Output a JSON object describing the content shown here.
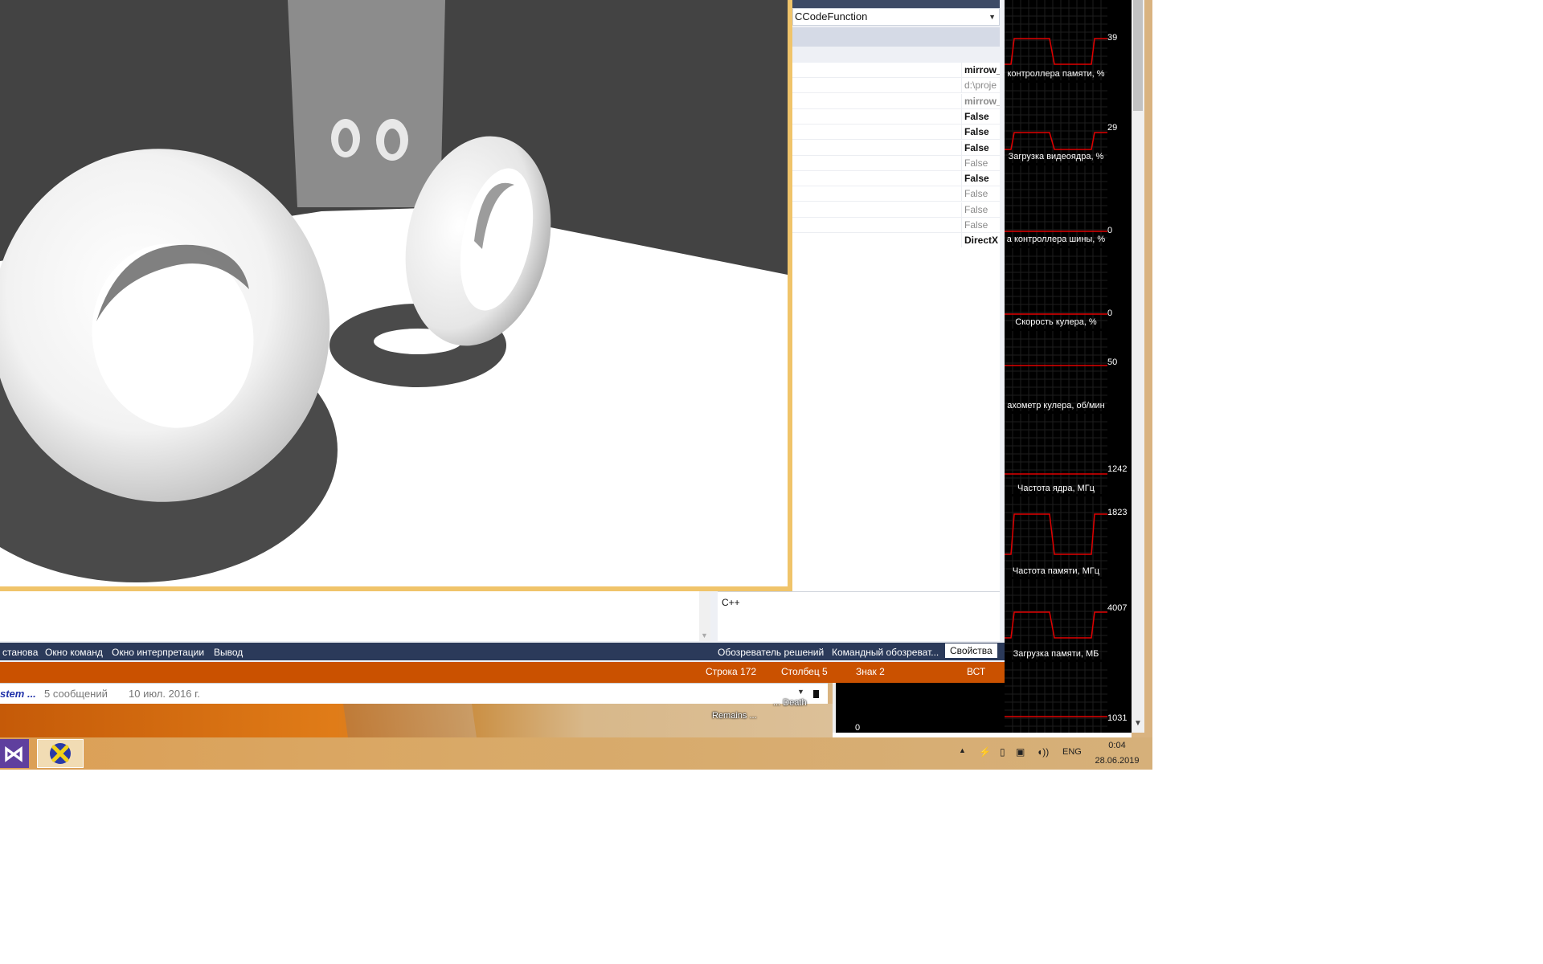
{
  "properties": {
    "combo_value": "CCodeFunction",
    "rows": [
      {
        "value": "mirrow_",
        "style": "b"
      },
      {
        "value": "d:\\proje",
        "style": "g"
      },
      {
        "value": "mirrow_",
        "style": "gb"
      },
      {
        "value": "False",
        "style": "b"
      },
      {
        "value": "False",
        "style": "b"
      },
      {
        "value": "False",
        "style": "b"
      },
      {
        "value": "False",
        "style": "g"
      },
      {
        "value": "False",
        "style": "b"
      },
      {
        "value": "False",
        "style": "g"
      },
      {
        "value": "False",
        "style": "g"
      },
      {
        "value": "False",
        "style": "g"
      },
      {
        "value": "DirectX",
        "style": "b"
      }
    ],
    "description": "C++"
  },
  "bottom_tabs_left": [
    "становa",
    "Окно команд",
    "Окно интерпретации",
    "Вывод"
  ],
  "bottom_tabs_right": [
    {
      "label": "Обозреватель решений",
      "active": false
    },
    {
      "label": "Командный обозреват...",
      "active": false
    },
    {
      "label": "Свойства",
      "active": true
    }
  ],
  "status": {
    "line": "Строка 172",
    "column": "Столбец 5",
    "char": "Знак 2",
    "mode": "ВСТ"
  },
  "forum": {
    "topic": "stem ...",
    "messages": "5 сообщений",
    "date": "10 июл. 2016 г."
  },
  "desktop_icons": [
    "Remains ...",
    "... Death"
  ],
  "gpu_monitor": {
    "graphs": [
      {
        "value": "39",
        "label": "контроллера памяти, %"
      },
      {
        "value": "29",
        "label": "Загрузка видеоядра, %"
      },
      {
        "value": "0",
        "label": "а контроллера шины, %"
      },
      {
        "value": "0",
        "label": "Скорость кулера, %"
      },
      {
        "value": "50",
        "label": "ахометр кулера, об/мин"
      },
      {
        "value": "1242",
        "label": "Частота ядра, МГц"
      },
      {
        "value": "1823",
        "label": "Частота памяти, МГц"
      },
      {
        "value": "4007",
        "label": "Загрузка памяти, МБ"
      },
      {
        "value": "1031",
        "label": ""
      }
    ],
    "last_axis_zero": "0"
  },
  "tray": {
    "language": "ENG",
    "time": "0:04",
    "date": "28.06.2019"
  },
  "colors": {
    "status_bar": "#ca5100",
    "tab_bar": "#2b3a5a",
    "graph_line": "#e00000",
    "render_border": "#f0c46a"
  }
}
